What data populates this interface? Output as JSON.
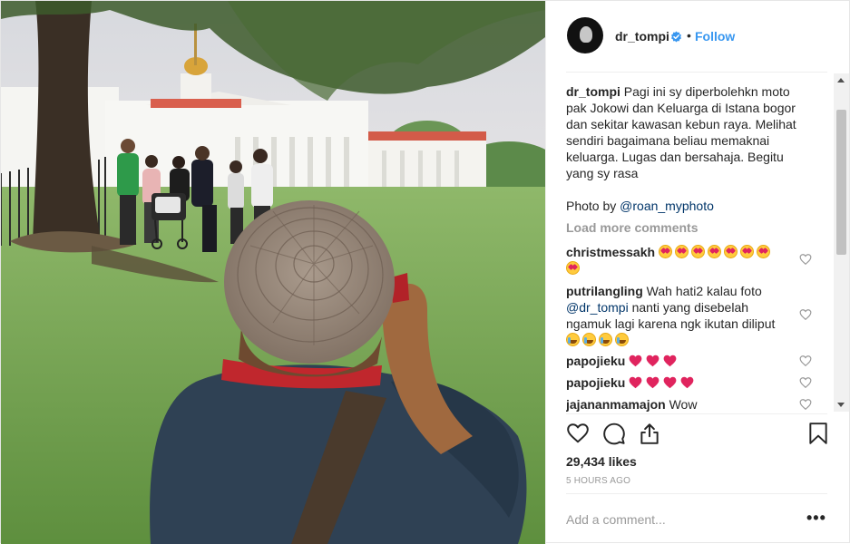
{
  "header": {
    "username": "dr_tompi",
    "verified_icon": "verified-badge-icon",
    "separator": "•",
    "follow_label": "Follow"
  },
  "caption": {
    "username": "dr_tompi",
    "text": "Pagi ini sy diperbolehkn moto pak Jokowi dan Keluarga di Istana bogor dan sekitar kawasan kebun raya. Melihat sendiri bagaimana beliau memaknai keluarga. Lugas dan bersahaja. Begitu yang sy rasa",
    "credit_prefix": "Photo by ",
    "credit_mention": "@roan_myphoto"
  },
  "load_more_label": "Load more comments",
  "comments": [
    {
      "username": "christmessakh",
      "text": "",
      "emoji": "heart-eyes-emoji",
      "emoji_count": 9
    },
    {
      "username": "putrilangling",
      "text": "Wah hati2 kalau foto",
      "mention": "@dr_tompi",
      "text2": "nanti yang disebelah ngamuk lagi karena ngk ikutan diliput",
      "emoji": "crying-emoji",
      "emoji_count": 4
    },
    {
      "username": "papojieku",
      "text": "",
      "emoji": "red-heart-emoji",
      "emoji_count": 3
    },
    {
      "username": "papojieku",
      "text": "",
      "emoji": "red-heart-emoji",
      "emoji_count": 4
    },
    {
      "username": "jajananmamajon",
      "text": "Wow"
    }
  ],
  "actions": {
    "like_icon": "heart-icon",
    "comment_icon": "comment-icon",
    "share_icon": "share-icon",
    "save_icon": "bookmark-icon"
  },
  "likes_text": "29,434 likes",
  "time_ago": "5 HOURS AGO",
  "add_comment": {
    "placeholder": "Add a comment..."
  },
  "more_label": "•••",
  "colors": {
    "link_blue": "#3897f0",
    "mention_blue": "#003569",
    "text": "#262626",
    "muted": "#999999",
    "divider": "#efefef"
  }
}
